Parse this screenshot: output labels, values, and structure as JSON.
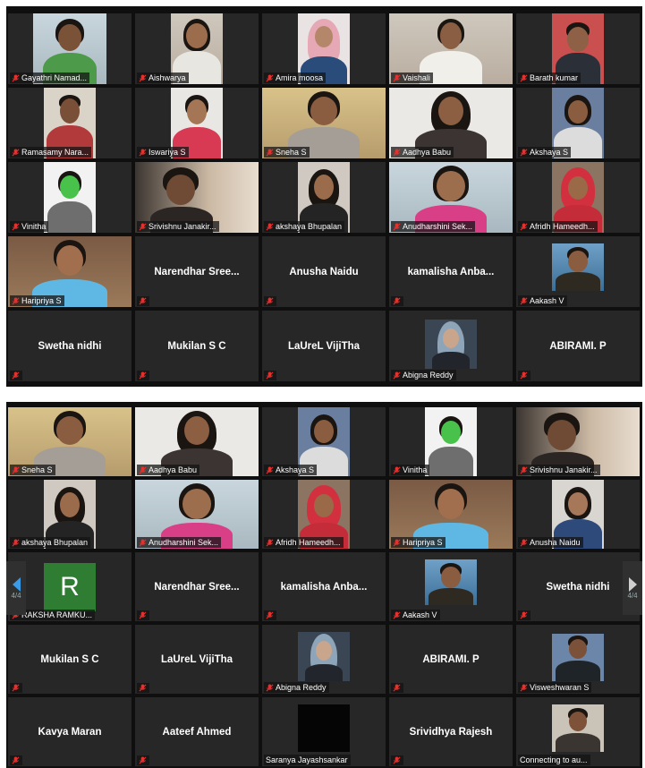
{
  "screen1": {
    "tiles": [
      {
        "name": "Gayathri Namad..."
      },
      {
        "name": "Aishwarya"
      },
      {
        "name": "Amira moosa"
      },
      {
        "name": "Vaishali"
      },
      {
        "name": "Barath kumar"
      },
      {
        "name": "Ramasamy Nara..."
      },
      {
        "name": "Iswariya S"
      },
      {
        "name": "Sneha S"
      },
      {
        "name": "Aadhya Babu"
      },
      {
        "name": "Akshaya S"
      },
      {
        "name": "Vinitha"
      },
      {
        "name": "Srivishnu Janakir..."
      },
      {
        "name": "akshaya Bhupalan"
      },
      {
        "name": "Anudharshini Sek..."
      },
      {
        "name": "Afridh Hameedh..."
      },
      {
        "name": "Haripriya S"
      },
      {
        "name": "Narendhar  Sree..."
      },
      {
        "name": "Anusha Naidu"
      },
      {
        "name": "kamalisha  Anba..."
      },
      {
        "name": "Aakash V"
      },
      {
        "name": "Swetha nidhi"
      },
      {
        "name": "Mukilan S C"
      },
      {
        "name": "LaUreL VijiTha"
      },
      {
        "name": "Abigna Reddy"
      },
      {
        "name": "ABIRAMI. P"
      }
    ]
  },
  "screen2": {
    "tiles": [
      {
        "name": "Sneha S"
      },
      {
        "name": "Aadhya Babu"
      },
      {
        "name": "Akshaya S"
      },
      {
        "name": "Vinitha"
      },
      {
        "name": "Srivishnu Janakir..."
      },
      {
        "name": "akshaya Bhupalan"
      },
      {
        "name": "Anudharshini Sek..."
      },
      {
        "name": "Afridh Hameedh..."
      },
      {
        "name": "Haripriya S"
      },
      {
        "name": "Anusha Naidu"
      },
      {
        "name": "RAKSHA RAMKU...",
        "avatar_letter": "R"
      },
      {
        "name": "Narendhar  Sree..."
      },
      {
        "name": "kamalisha  Anba..."
      },
      {
        "name": "Aakash V"
      },
      {
        "name": "Swetha nidhi"
      },
      {
        "name": "Mukilan S C"
      },
      {
        "name": "LaUreL VijiTha"
      },
      {
        "name": "Abigna Reddy"
      },
      {
        "name": "ABIRAMI. P"
      },
      {
        "name": "Visweshwaran S"
      },
      {
        "name": "Kavya Maran"
      },
      {
        "name": "Aateef Ahmed"
      },
      {
        "name": "Saranya Jayashsankar"
      },
      {
        "name": "Srividhya Rajesh"
      },
      {
        "name": "Connecting to au..."
      }
    ],
    "page_left": "4/4",
    "page_right": "4/4"
  },
  "colors": {
    "muted_mic": "#e0332f",
    "tile_bg": "#272727",
    "screen_bg": "#0f0f0f",
    "arrow_active": "#3a9be8"
  }
}
